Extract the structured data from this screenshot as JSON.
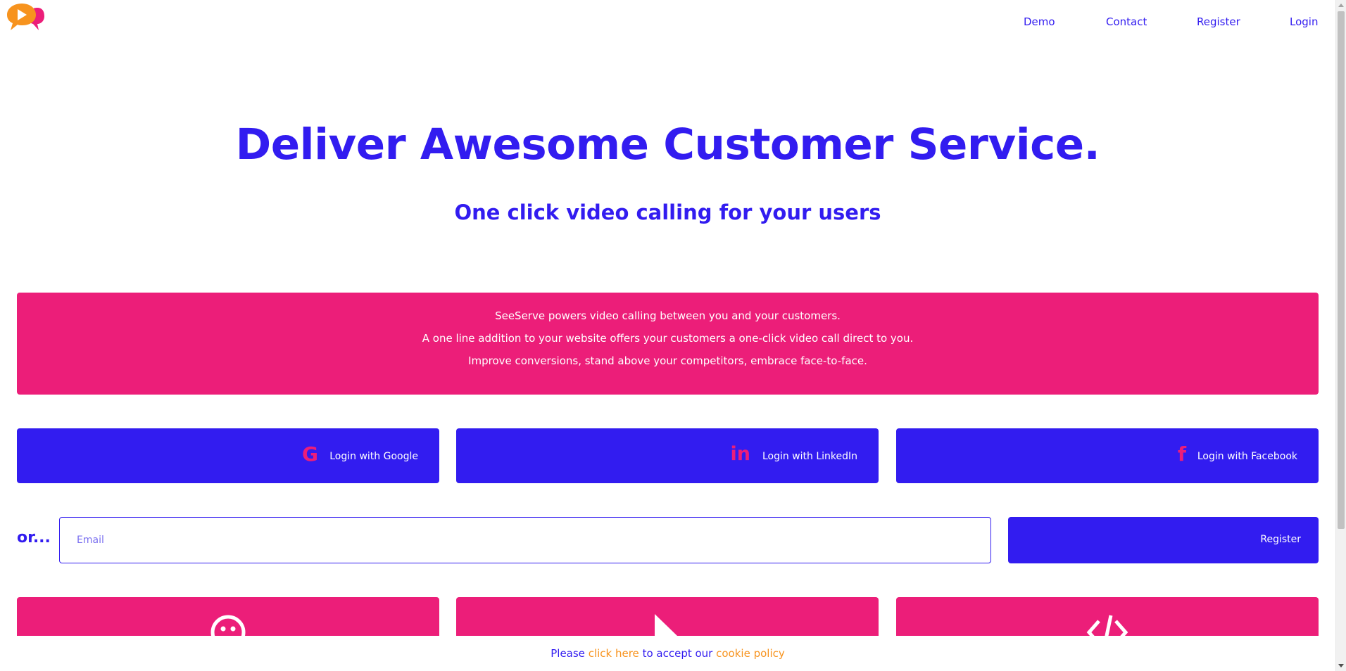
{
  "nav": {
    "items": [
      {
        "label": "Demo"
      },
      {
        "label": "Contact"
      },
      {
        "label": "Register"
      },
      {
        "label": "Login"
      }
    ]
  },
  "hero": {
    "title": "Deliver Awesome Customer Service.",
    "subtitle": "One click video calling for your users"
  },
  "info": {
    "lines": [
      "SeeServe powers video calling between you and your customers.",
      "A one line addition to your website offers your customers a one-click video call direct to you.",
      "Improve conversions, stand above your competitors, embrace face-to-face."
    ]
  },
  "social": {
    "google": {
      "label": "Login with Google",
      "icon": "google-icon"
    },
    "linkedin": {
      "label": "Login with LinkedIn",
      "icon": "linkedin-icon"
    },
    "facebook": {
      "label": "Login with Facebook",
      "icon": "facebook-icon"
    }
  },
  "signup": {
    "or_label": "or...",
    "email_placeholder": "Email",
    "register_label": "Register"
  },
  "cards": [
    {
      "icon": "smiley-icon"
    },
    {
      "icon": "cursor-pointer-icon"
    },
    {
      "icon": "code-icon"
    }
  ],
  "cookie": {
    "prefix": "Please",
    "link1": "click here",
    "middle": "to accept our",
    "link2": "cookie policy"
  },
  "colors": {
    "brand_blue": "#321cf0",
    "brand_pink": "#ec1e79",
    "brand_orange": "#f7931e"
  }
}
